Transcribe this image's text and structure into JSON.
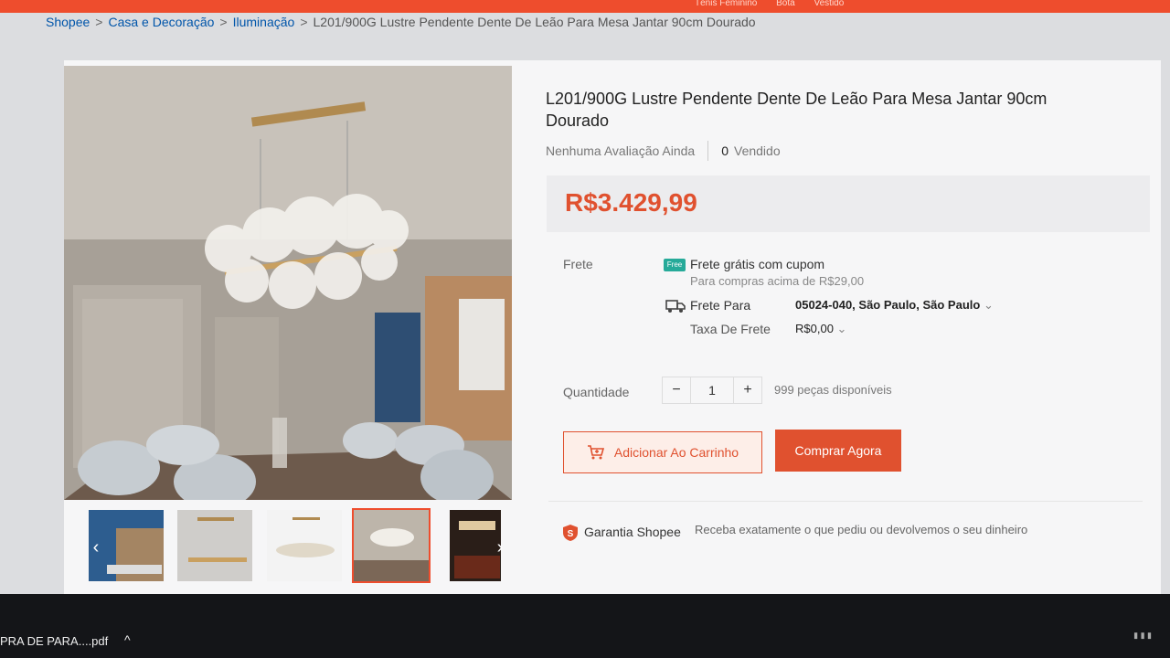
{
  "topbar": {
    "links": [
      "Tênis Feminino",
      "Bota",
      "Vestido"
    ]
  },
  "breadcrumb": [
    "Shopee",
    "Casa e Decoração",
    "Iluminação",
    "L201/900G Lustre Pendente Dente De Leão Para Mesa Jantar 90cm Dourado"
  ],
  "product": {
    "title": "L201/900G Lustre Pendente Dente De Leão Para Mesa Jantar 90cm Dourado",
    "rating_text": "Nenhuma Avaliação Ainda",
    "sold_count": "0",
    "sold_label": "Vendido",
    "price": "R$3.429,99"
  },
  "shipping": {
    "label": "Frete",
    "badge": "Free",
    "free_text": "Frete grátis com cupom",
    "free_sub": "Para compras acima de R$29,00",
    "to_label": "Frete Para",
    "to_value": "05024-040, São Paulo, São Paulo",
    "fee_label": "Taxa De Frete",
    "fee_value": "R$0,00"
  },
  "quantity": {
    "label": "Quantidade",
    "minus": "−",
    "value": "1",
    "plus": "+",
    "available": "999 peças disponíveis"
  },
  "actions": {
    "add_to_cart": "Adicionar Ao Carrinho",
    "buy_now": "Comprar Agora"
  },
  "guarantee": {
    "title": "Garantia Shopee",
    "text": "Receba exatamente o que pediu ou devolvemos o seu dinheiro"
  },
  "taskbar": {
    "download": "PRA DE PARA....pdf",
    "caret": "^"
  },
  "colors": {
    "brand": "#ee4d2d",
    "price": "#e0512f",
    "free_badge": "#26aa99",
    "link": "#0055aa"
  }
}
